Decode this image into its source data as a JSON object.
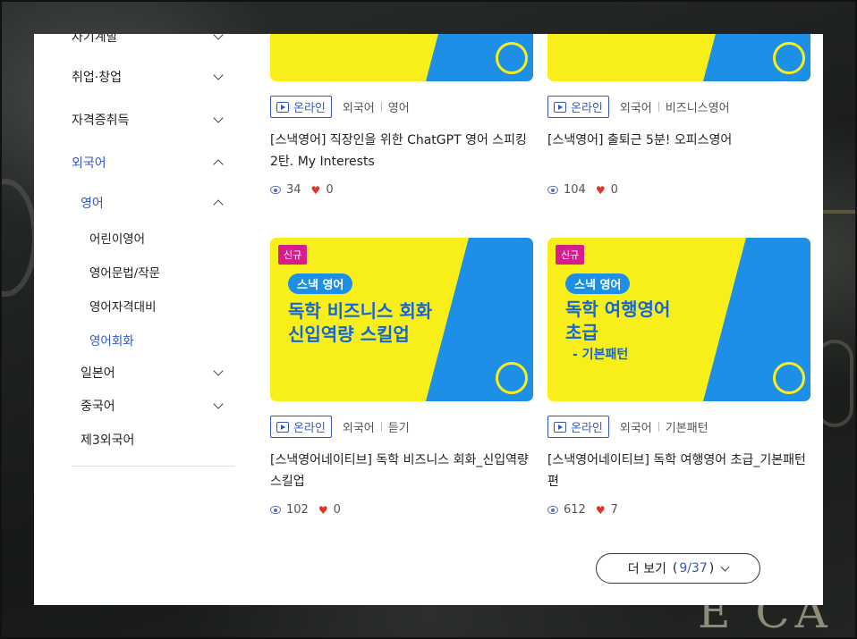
{
  "sidebar": {
    "top_cut": "자기계발",
    "career": "취업·창업",
    "cert": "자격증취득",
    "foreign": "외국어",
    "english": "영어",
    "english_items": [
      "어린이영어",
      "영어문법/작문",
      "영어자격대비",
      "영어회화"
    ],
    "japanese": "일본어",
    "chinese": "중국어",
    "third": "제3외국어"
  },
  "common": {
    "online": "온라인",
    "new_badge": "신규"
  },
  "cards": [
    {
      "cat1": "외국어",
      "cat2": "영어",
      "title": "[스낵영어] 직장인을 위한 ChatGPT 영어 스피킹 2탄. My Interests",
      "views": "34",
      "likes": "0"
    },
    {
      "cat1": "외국어",
      "cat2": "비즈니스영어",
      "title": "[스낵영어] 출퇴근 5분! 오피스영어",
      "views": "104",
      "likes": "0"
    },
    {
      "cat1": "외국어",
      "cat2": "듣기",
      "title": "[스낵영어네이티브] 독학 비즈니스 회화_신입역량 스킬업",
      "views": "102",
      "likes": "0",
      "thumb": {
        "tag": "스낵 영어",
        "line1": "독학 비즈니스 회화",
        "line2": "신입역량 스킬업"
      }
    },
    {
      "cat1": "외국어",
      "cat2": "기본패턴",
      "title": "[스낵영어네이티브] 독학 여행영어 초급_기본패턴 편",
      "views": "612",
      "likes": "7",
      "thumb": {
        "tag": "스낵 영어",
        "line1": "독학 여행영어",
        "line2": "초급",
        "sub": "- 기본패턴"
      }
    }
  ],
  "more": {
    "label": "더 보기",
    "open": "(",
    "count": "9/37",
    "close": ")"
  },
  "background": {
    "sign": "E CA"
  },
  "colors": {
    "accent": "#3457c4",
    "thumb_yellow": "#f8ef1a",
    "thumb_blue": "#1d8fe6",
    "badge": "#d61d8e",
    "heart": "#e0342b"
  }
}
